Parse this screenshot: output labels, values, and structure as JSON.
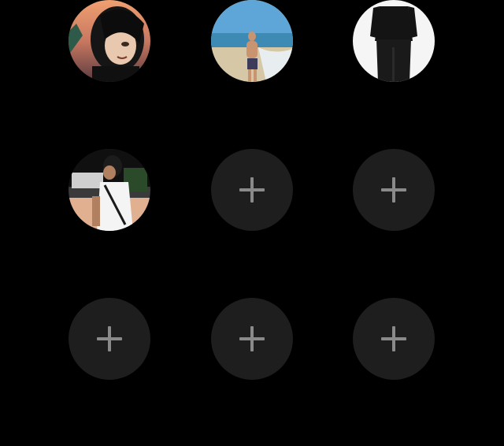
{
  "profile_slots": [
    {
      "state": "filled",
      "icon": "avatar-anime-character"
    },
    {
      "state": "filled",
      "icon": "avatar-beach-person"
    },
    {
      "state": "filled",
      "icon": "avatar-black-outfit"
    },
    {
      "state": "filled",
      "icon": "avatar-white-tshirt-person"
    },
    {
      "state": "empty",
      "icon": "plus-icon"
    },
    {
      "state": "empty",
      "icon": "plus-icon"
    },
    {
      "state": "empty",
      "icon": "plus-icon"
    },
    {
      "state": "empty",
      "icon": "plus-icon"
    },
    {
      "state": "empty",
      "icon": "plus-icon"
    }
  ],
  "colors": {
    "background": "#000000",
    "empty_slot": "#1e1e1e",
    "plus": "#8a8a8a"
  }
}
